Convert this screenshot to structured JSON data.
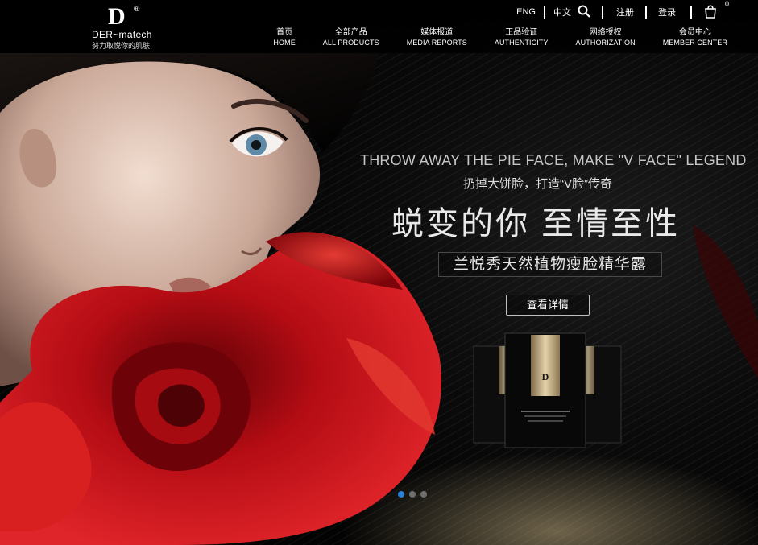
{
  "brand": {
    "mark": "D",
    "reg": "®",
    "name": "DER~matech",
    "tagline": "努力取悦你的肌肤"
  },
  "utility": {
    "lang_en": "ENG",
    "lang_cn": "中文",
    "search_icon": "search-icon",
    "register": "注册",
    "login": "登录",
    "cart_icon": "shopping-bag-icon",
    "cart_count": "0"
  },
  "nav": [
    {
      "cn": "首页",
      "en": "HOME"
    },
    {
      "cn": "全部产品",
      "en": "ALL PRODUCTS"
    },
    {
      "cn": "媒体报道",
      "en": "MEDIA REPORTS"
    },
    {
      "cn": "正品验证",
      "en": "AUTHENTICITY"
    },
    {
      "cn": "网络授权",
      "en": "AUTHORIZATION"
    },
    {
      "cn": "会员中心",
      "en": "MEMBER CENTER"
    }
  ],
  "slide": {
    "headline_en": "THROW AWAY THE PIE FACE, MAKE \"V FACE\" LEGEND",
    "subtitle_cn": "扔掉大饼脸，打造“V脸”传奇",
    "headline_cn": "蜕变的你  至情至性",
    "product_name": "兰悦秀天然植物瘦脸精华露",
    "detail_button": "查看详情"
  },
  "slider": {
    "total_slides": 3,
    "active_slide": 1
  },
  "colors": {
    "rose": "#c4121a",
    "accent_dot": "#2b7fd8",
    "gold": "#b9a27a"
  }
}
